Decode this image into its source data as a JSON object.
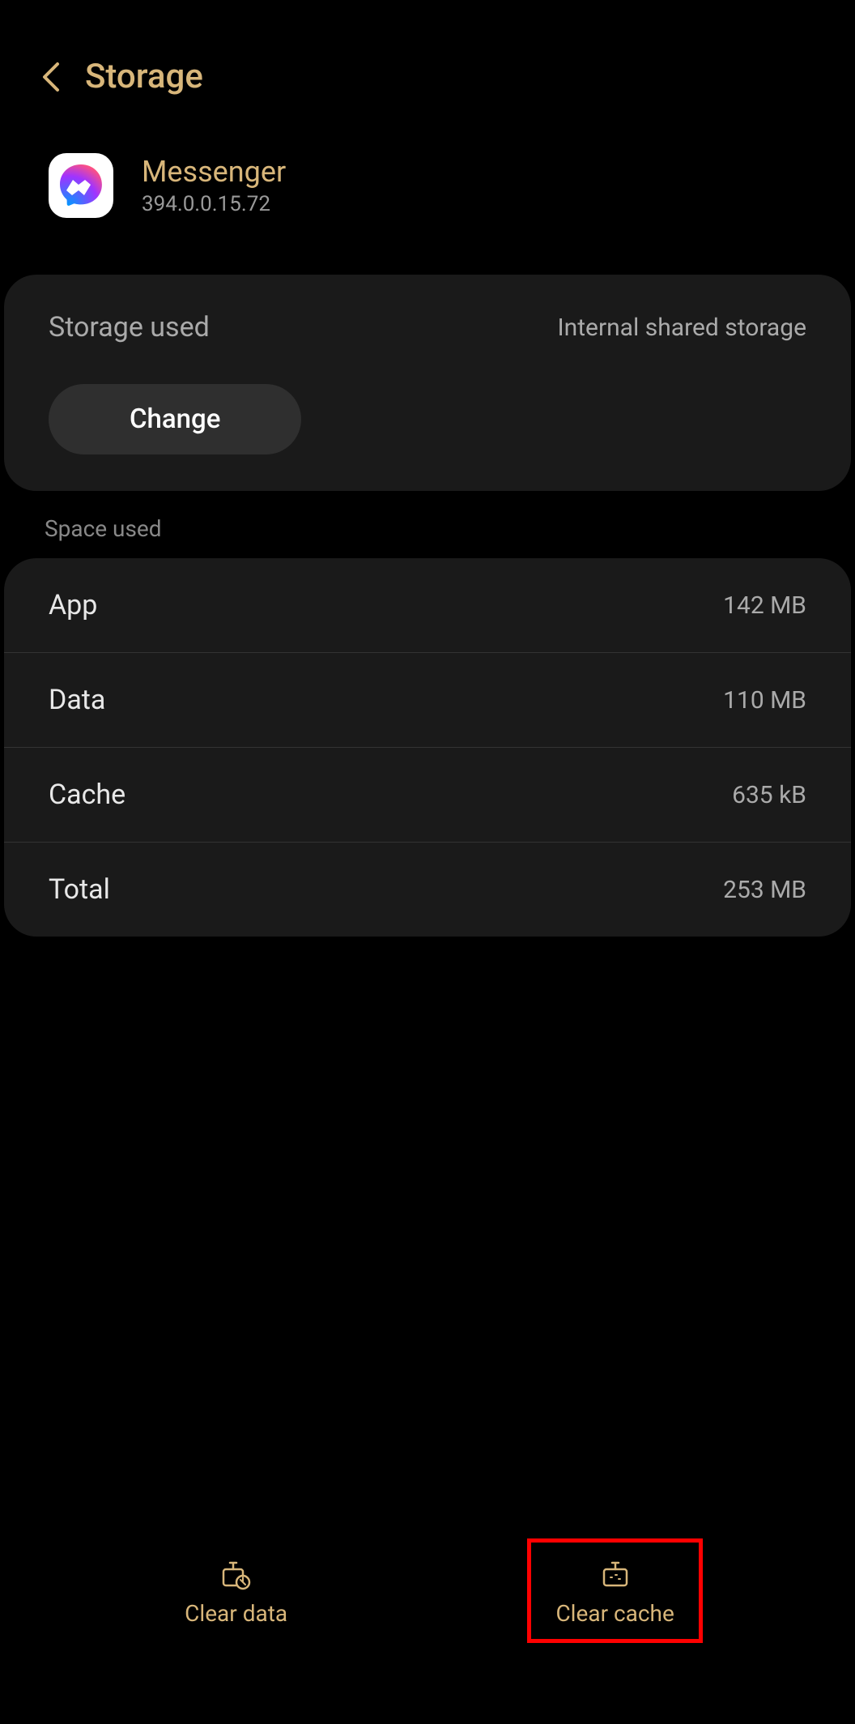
{
  "header": {
    "title": "Storage"
  },
  "app": {
    "name": "Messenger",
    "version": "394.0.0.15.72"
  },
  "storage": {
    "used_label": "Storage used",
    "location": "Internal shared storage",
    "change_button": "Change"
  },
  "space": {
    "section_label": "Space used",
    "rows": [
      {
        "label": "App",
        "value": "142 MB"
      },
      {
        "label": "Data",
        "value": "110 MB"
      },
      {
        "label": "Cache",
        "value": "635 kB"
      },
      {
        "label": "Total",
        "value": "253 MB"
      }
    ]
  },
  "actions": {
    "clear_data": "Clear data",
    "clear_cache": "Clear cache"
  },
  "colors": {
    "accent": "#d8b67a",
    "card_bg": "#1a1a1a",
    "highlight": "#ff0000"
  }
}
